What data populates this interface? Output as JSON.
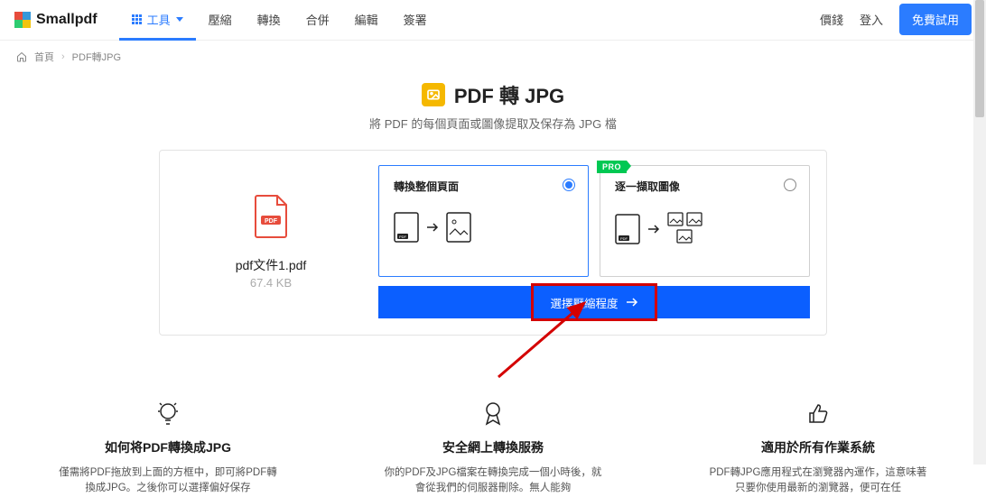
{
  "brand": "Smallpdf",
  "nav": {
    "tools": "工具",
    "items": [
      "壓縮",
      "轉換",
      "合併",
      "編輯",
      "簽署"
    ],
    "price": "價錢",
    "login": "登入",
    "try": "免費試用"
  },
  "breadcrumb": {
    "home": "首頁",
    "current": "PDF轉JPG"
  },
  "hero": {
    "title": "PDF 轉 JPG",
    "subtitle": "將 PDF 的每個頁面或圖像提取及保存為 JPG 檔"
  },
  "file": {
    "name": "pdf文件1.pdf",
    "size": "67.4 KB"
  },
  "options": {
    "convert_pages": "轉換整個頁面",
    "extract_images": "逐一擷取圖像",
    "pro_label": "PRO"
  },
  "choose_button": "選擇壓縮程度",
  "features": [
    {
      "title": "如何将PDF轉換成JPG",
      "desc": "僅需將PDF拖放到上面的方框中，即可將PDF轉換成JPG。之後你可以選擇偏好保存"
    },
    {
      "title": "安全網上轉換服務",
      "desc": "你的PDF及JPG檔案在轉換完成一個小時後，就會從我們的伺服器刪除。無人能夠"
    },
    {
      "title": "適用於所有作業系統",
      "desc": "PDF轉JPG應用程式在瀏覽器內運作，這意味著只要你使用最新的瀏覽器，便可在任"
    }
  ]
}
